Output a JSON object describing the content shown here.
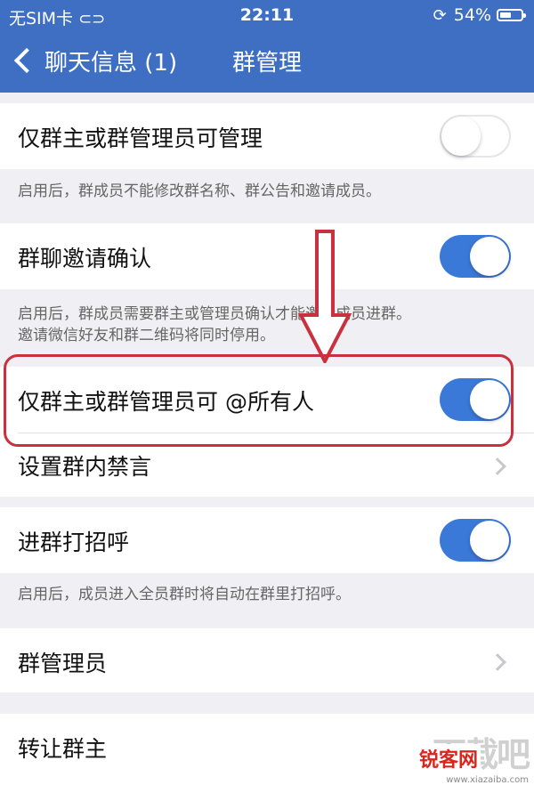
{
  "status_bar": {
    "carrier": "无SIM卡",
    "time": "22:11",
    "battery": "54%",
    "battery_level": 0.54
  },
  "nav": {
    "back_label": "聊天信息 (1)",
    "title": "群管理"
  },
  "settings": {
    "admin_only_manage": {
      "label": "仅群主或群管理员可管理",
      "enabled": false
    },
    "admin_only_manage_hint": "启用后，群成员不能修改群名称、群公告和邀请成员。",
    "invite_confirm": {
      "label": "群聊邀请确认",
      "enabled": true
    },
    "invite_confirm_hint_line1": "启用后，群成员需要群主或管理员确认才能邀请成员进群。",
    "invite_confirm_hint_line2": "邀请微信好友和群二维码将同时停用。",
    "admin_only_at_all": {
      "label": "仅群主或群管理员可 @所有人",
      "enabled": true
    },
    "mute": {
      "label": "设置群内禁言"
    },
    "greet": {
      "label": "进群打招呼",
      "enabled": true
    },
    "greet_hint": "启用后，成员进入全员群时将自动在群里打招呼。",
    "admins": {
      "label": "群管理员"
    },
    "transfer": {
      "label": "转让群主"
    }
  },
  "watermark": {
    "big": "下载吧",
    "brand": "锐客网",
    "url": "www.xiazaiba.com"
  },
  "colors": {
    "nav_bg": "#3f6fc2",
    "toggle_on": "#3b79d8",
    "highlight": "#c9313e"
  }
}
